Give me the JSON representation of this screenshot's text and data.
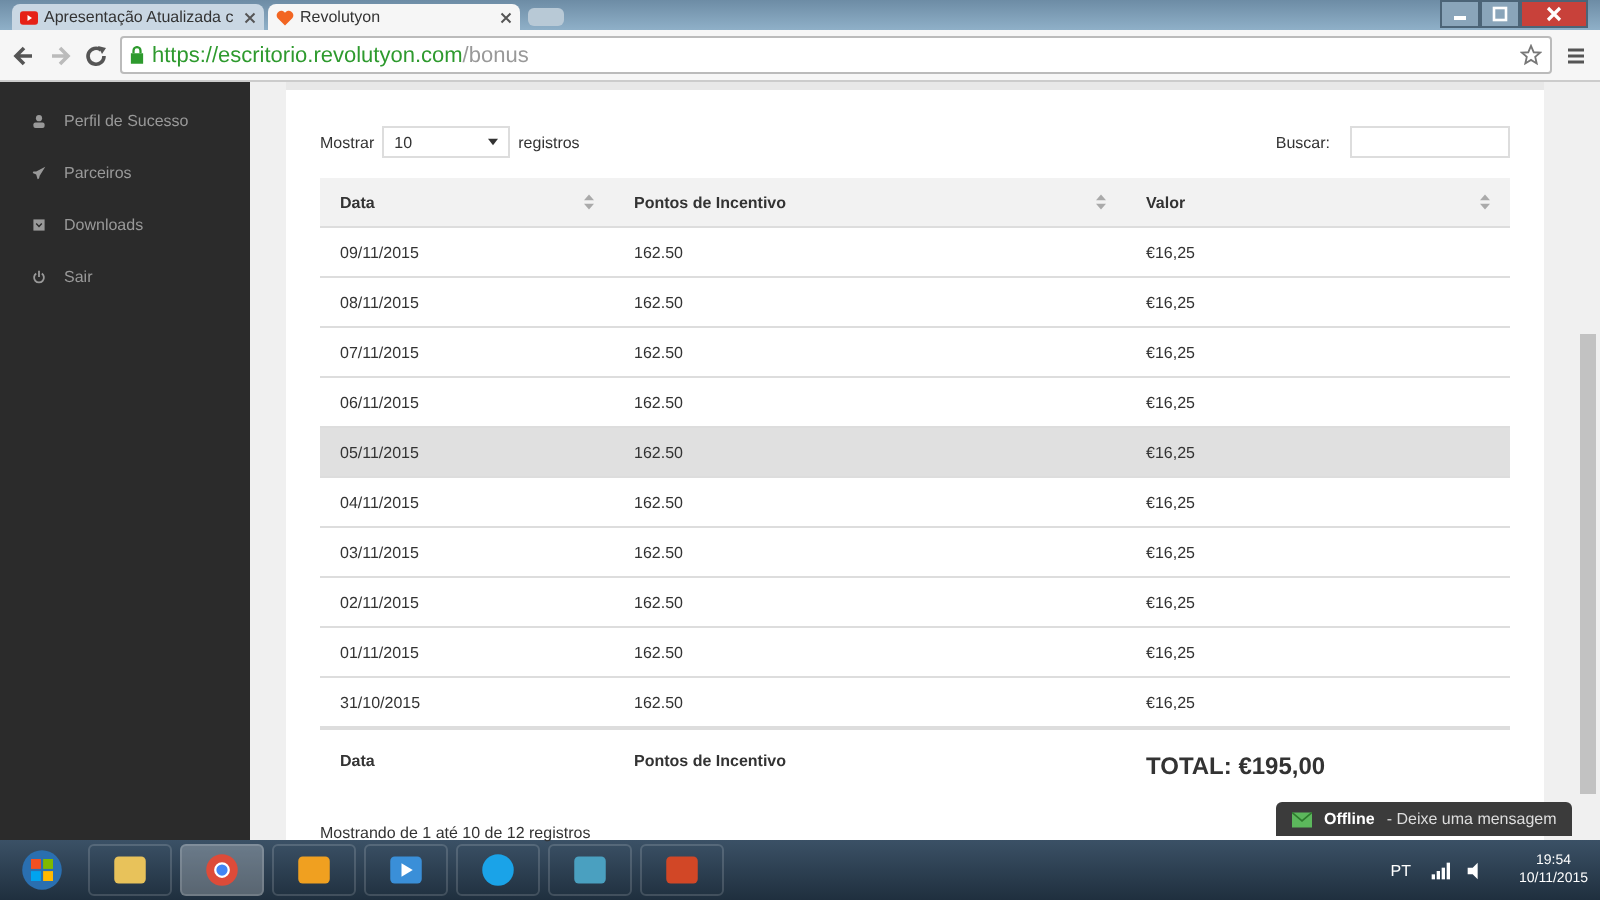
{
  "browser": {
    "tabs": [
      {
        "title": "Apresentação Atualizada c",
        "kind": "video",
        "selected": false
      },
      {
        "title": "Revolutyon",
        "kind": "site",
        "selected": true
      }
    ],
    "url": {
      "host": "https://escritorio.revolutyon.com",
      "path": "/bonus"
    }
  },
  "sidebar": {
    "items": [
      {
        "label": "Perfil de Sucesso",
        "kind": "user"
      },
      {
        "label": "Parceiros",
        "kind": "rocket"
      },
      {
        "label": "Downloads",
        "kind": "download"
      },
      {
        "label": "Sair",
        "kind": "power"
      }
    ]
  },
  "table_controls": {
    "show_label": "Mostrar",
    "page_size": "10",
    "records_label": "registros",
    "search_label": "Buscar:"
  },
  "table": {
    "columns": [
      "Data",
      "Pontos de Incentivo",
      "Valor"
    ],
    "rows": [
      {
        "cells": [
          "09/11/2015",
          "162.50",
          "€16,25"
        ],
        "highlighted": false
      },
      {
        "cells": [
          "08/11/2015",
          "162.50",
          "€16,25"
        ],
        "highlighted": false
      },
      {
        "cells": [
          "07/11/2015",
          "162.50",
          "€16,25"
        ],
        "highlighted": false
      },
      {
        "cells": [
          "06/11/2015",
          "162.50",
          "€16,25"
        ],
        "highlighted": false
      },
      {
        "cells": [
          "05/11/2015",
          "162.50",
          "€16,25"
        ],
        "highlighted": true
      },
      {
        "cells": [
          "04/11/2015",
          "162.50",
          "€16,25"
        ],
        "highlighted": false
      },
      {
        "cells": [
          "03/11/2015",
          "162.50",
          "€16,25"
        ],
        "highlighted": false
      },
      {
        "cells": [
          "02/11/2015",
          "162.50",
          "€16,25"
        ],
        "highlighted": false
      },
      {
        "cells": [
          "01/11/2015",
          "162.50",
          "€16,25"
        ],
        "highlighted": false
      },
      {
        "cells": [
          "31/10/2015",
          "162.50",
          "€16,25"
        ],
        "highlighted": false
      }
    ],
    "footer": [
      "Data",
      "Pontos de Incentivo",
      "TOTAL: €195,00"
    ]
  },
  "info": "Mostrando de 1 até 10 de 12 registros",
  "chat": {
    "status": "Offline",
    "message": "- Deixe uma mensagem"
  },
  "taskbar": {
    "apps": [
      {
        "kind": "folder",
        "active": false
      },
      {
        "kind": "browser",
        "active": true
      },
      {
        "kind": "mail",
        "active": false
      },
      {
        "kind": "media",
        "active": false
      },
      {
        "kind": "chat",
        "active": false
      },
      {
        "kind": "photo",
        "active": false
      },
      {
        "kind": "slides",
        "active": false
      }
    ],
    "language": "PT",
    "time": "19:54",
    "date": "10/11/2015"
  }
}
